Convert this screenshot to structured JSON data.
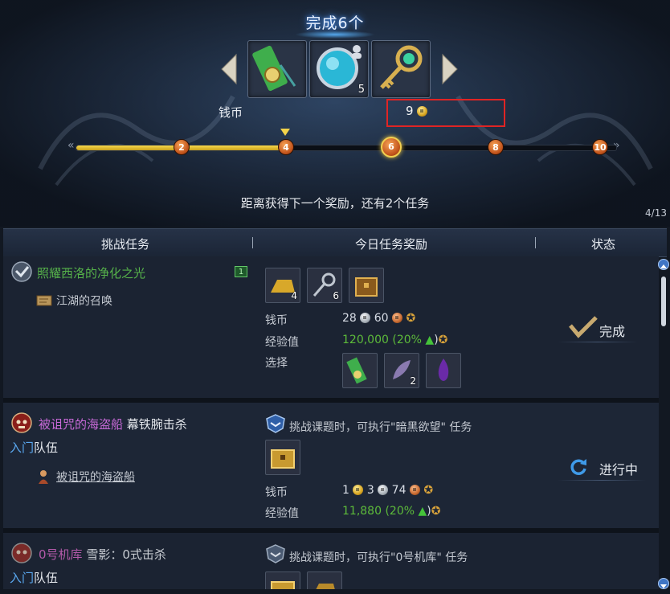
{
  "title": "完成6个",
  "reward_slots": [
    {
      "name": "bound-pouch",
      "count": ""
    },
    {
      "name": "crystal-orb",
      "count": "5"
    },
    {
      "name": "jewel-key",
      "count": ""
    }
  ],
  "coin_label": "钱币",
  "coin_value": "9",
  "milestones": [
    "2",
    "4",
    "6",
    "8",
    "10"
  ],
  "current_milestone": "6",
  "progress_fraction": 0.39,
  "next_reward_hint": "距离获得下一个奖励，还有2个任务",
  "page_count": "4/13",
  "headers": {
    "task": "挑战任务",
    "reward": "今日任务奖励",
    "status": "状态"
  },
  "tasks": [
    {
      "title": "照耀西洛的净化之光",
      "subtitle": "江湖的召唤",
      "badge": "1",
      "items": [
        {
          "count": "4"
        },
        {
          "count": "6"
        },
        {
          "count": ""
        }
      ],
      "coin_label": "钱币",
      "coin": {
        "silver": "28",
        "copper": "60"
      },
      "exp_label": "经验值",
      "exp_value": "120,000",
      "exp_bonus_open": "(20%",
      "exp_bonus_close": ")",
      "choice_label": "选择",
      "choices": [
        {
          "count": ""
        },
        {
          "count": "2"
        },
        {
          "count": ""
        }
      ],
      "status": "完成"
    },
    {
      "title": "被诅咒的海盗船",
      "title_suffix": "幕铁腕击杀",
      "level": "入门",
      "party": "队伍",
      "location": "被诅咒的海盗船",
      "note": "挑战课题时，可执行\"暗黑欲望\" 任务",
      "coin_label": "钱币",
      "coin": {
        "gold": "1",
        "silver": "3",
        "copper": "74"
      },
      "exp_label": "经验值",
      "exp_value": "11,880",
      "exp_bonus_open": "(20%",
      "exp_bonus_close": ")",
      "status": "进行中"
    },
    {
      "title": "0号机库",
      "title_suffix": "雪影：0式击杀",
      "level": "入门",
      "party": "队伍",
      "note": "挑战课题时，可执行\"0号机库\" 任务"
    }
  ],
  "colors": {
    "accent_gold": "#f3d34a",
    "milestone_orange": "#c2541c",
    "highlight_red": "#e02424",
    "complete_green": "#56b24a",
    "dungeon_purple": "#c86ad8",
    "level_blue": "#5aa8f0"
  }
}
